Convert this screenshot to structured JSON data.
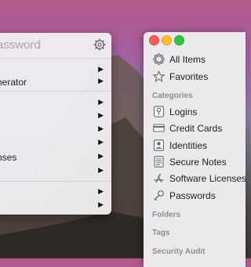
{
  "popup": {
    "search_placeholder": "assword",
    "rows": [
      {
        "label": "",
        "has_arrow": true
      },
      {
        "label": "nerator",
        "has_arrow": true
      },
      {
        "label": "",
        "has_arrow": true
      },
      {
        "label": "",
        "has_arrow": true
      },
      {
        "label": "",
        "has_arrow": true
      },
      {
        "label": "",
        "has_arrow": true
      },
      {
        "label": "nses",
        "has_arrow": true
      },
      {
        "label": "",
        "has_arrow": true
      },
      {
        "label": "",
        "has_arrow": true
      },
      {
        "label": "",
        "has_arrow": true
      }
    ],
    "arrow_glyph": "▶"
  },
  "window": {
    "traffic_lights": {
      "close": "#fd5f57",
      "minimize": "#fdbd2e",
      "zoom": "#29c940"
    }
  },
  "sidebar": {
    "top_items": [
      {
        "label": "All Items",
        "icon": "all-items-icon"
      },
      {
        "label": "Favorites",
        "icon": "star-icon"
      }
    ],
    "categories_header": "Categories",
    "categories": [
      {
        "label": "Logins",
        "icon": "key-icon"
      },
      {
        "label": "Credit Cards",
        "icon": "credit-card-icon"
      },
      {
        "label": "Identities",
        "icon": "identity-icon"
      },
      {
        "label": "Secure Notes",
        "icon": "note-icon"
      },
      {
        "label": "Software Licenses",
        "icon": "app-store-icon"
      },
      {
        "label": "Passwords",
        "icon": "password-key-icon"
      }
    ],
    "folders_header": "Folders",
    "tags_header": "Tags",
    "security_audit_header": "Security Audit"
  }
}
